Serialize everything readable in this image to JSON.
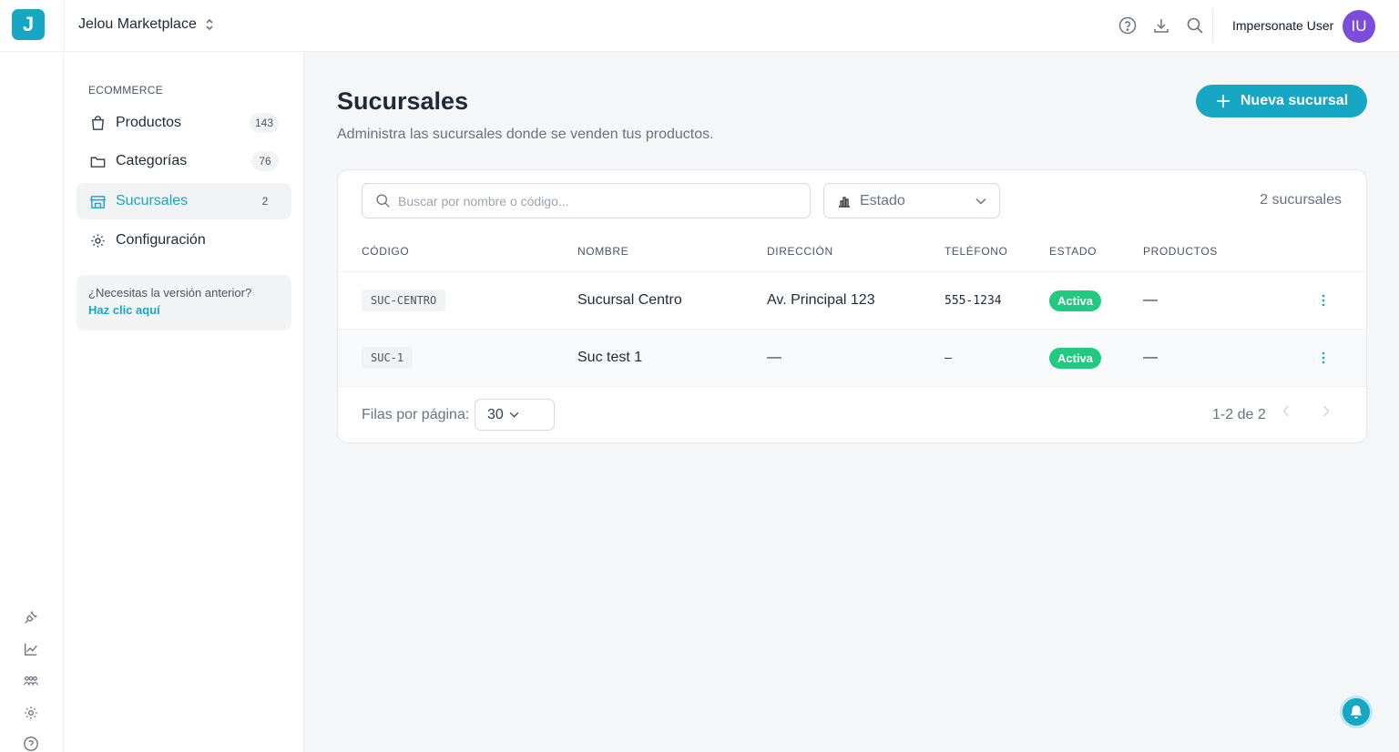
{
  "header": {
    "logo_letter": "J",
    "workspace": "Jelou Marketplace",
    "user_name": "Impersonate User",
    "avatar_initials": "IU"
  },
  "rail_icons": [
    "plug-icon",
    "chart-line-icon",
    "users-icon",
    "gear-icon",
    "help-circle-icon"
  ],
  "sidebar": {
    "section": "ECOMMERCE",
    "items": [
      {
        "label": "Productos",
        "count": "143",
        "icon": "shopping-bag-icon"
      },
      {
        "label": "Categorías",
        "count": "76",
        "icon": "folder-icon"
      },
      {
        "label": "Sucursales",
        "count": "2",
        "icon": "store-icon",
        "active": true
      },
      {
        "label": "Configuración",
        "count": "",
        "icon": "gear-icon"
      }
    ],
    "legacy_question": "¿Necesitas la versión anterior?",
    "legacy_link": "Haz clic aquí"
  },
  "main": {
    "title": "Sucursales",
    "subtitle": "Administra las sucursales donde se venden tus productos.",
    "new_button": "Nueva sucursal",
    "search_placeholder": "Buscar por nombre o código...",
    "estado_filter": "Estado",
    "count_label": "2 sucursales",
    "columns": [
      "CÓDIGO",
      "NOMBRE",
      "DIRECCIÓN",
      "TELÉFONO",
      "ESTADO",
      "PRODUCTOS"
    ],
    "rows": [
      {
        "code": "SUC-CENTRO",
        "name": "Sucursal Centro",
        "address": "Av. Principal 123",
        "phone": "555-1234",
        "status": "Activa",
        "products": "—"
      },
      {
        "code": "SUC-1",
        "name": "Suc test 1",
        "address": "—",
        "phone": "–",
        "status": "Activa",
        "products": "—"
      }
    ],
    "rows_per_page_label": "Filas por página:",
    "rows_per_page": "30",
    "range": "1-2 de 2"
  },
  "colors": {
    "accent": "#17a6c4",
    "status_active": "#22c983",
    "avatar": "#7c4ddb"
  }
}
